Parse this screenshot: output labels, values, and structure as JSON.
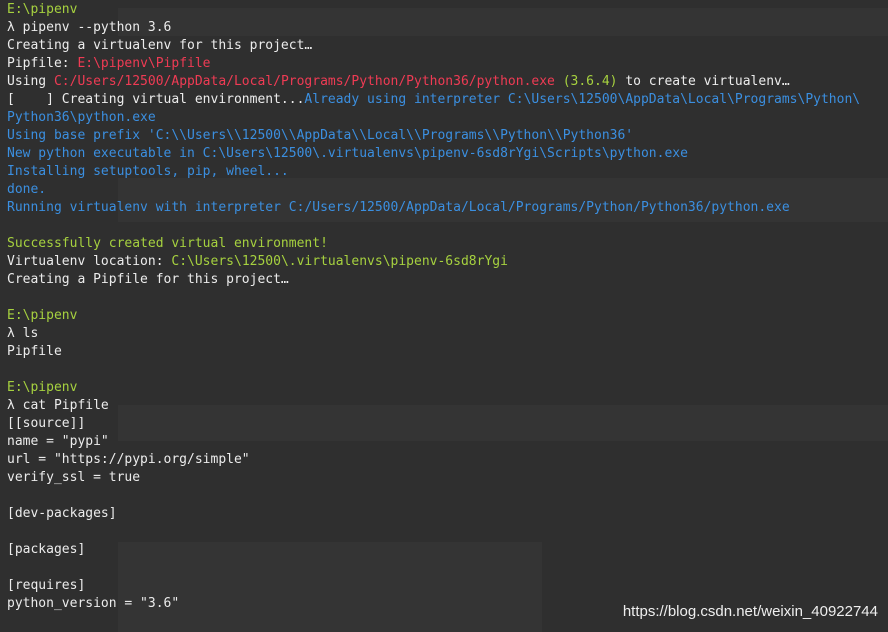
{
  "terminal": {
    "lines": [
      [
        {
          "t": "E:\\pipenv",
          "c": "green"
        }
      ],
      [
        {
          "t": "λ pipenv --python 3.6",
          "c": "white"
        }
      ],
      [
        {
          "t": "Creating a virtualenv for this project…",
          "c": "white"
        }
      ],
      [
        {
          "t": "Pipfile: ",
          "c": "white"
        },
        {
          "t": "E:\\pipenv\\Pipfile",
          "c": "red"
        }
      ],
      [
        {
          "t": "Using ",
          "c": "white"
        },
        {
          "t": "C:/Users/12500/AppData/Local/Programs/Python/Python36/python.exe",
          "c": "red"
        },
        {
          "t": " (3.6.4)",
          "c": "green"
        },
        {
          "t": " to create virtualenv…",
          "c": "white"
        }
      ],
      [
        {
          "t": "[    ] Creating virtual environment...",
          "c": "white"
        },
        {
          "t": "Already using interpreter C:\\Users\\12500\\AppData\\Local\\Programs\\Python\\",
          "c": "blue"
        }
      ],
      [
        {
          "t": "Python36\\python.exe",
          "c": "blue"
        }
      ],
      [
        {
          "t": "Using base prefix 'C:\\\\Users\\\\12500\\\\AppData\\\\Local\\\\Programs\\\\Python\\\\Python36'",
          "c": "blue"
        }
      ],
      [
        {
          "t": "New python executable in C:\\Users\\12500\\.virtualenvs\\pipenv-6sd8rYgi\\Scripts\\python.exe",
          "c": "blue"
        }
      ],
      [
        {
          "t": "Installing setuptools, pip, wheel...",
          "c": "blue"
        }
      ],
      [
        {
          "t": "done.",
          "c": "blue"
        }
      ],
      [
        {
          "t": "Running virtualenv with interpreter C:/Users/12500/AppData/Local/Programs/Python/Python36/python.exe",
          "c": "blue"
        }
      ],
      [
        {
          "t": "",
          "c": "white"
        }
      ],
      [
        {
          "t": "Successfully created virtual environment!",
          "c": "green"
        }
      ],
      [
        {
          "t": "Virtualenv location: ",
          "c": "white"
        },
        {
          "t": "C:\\Users\\12500\\.virtualenvs\\pipenv-6sd8rYgi",
          "c": "green"
        }
      ],
      [
        {
          "t": "Creating a Pipfile for this project…",
          "c": "white"
        }
      ],
      [
        {
          "t": "",
          "c": "white"
        }
      ],
      [
        {
          "t": "E:\\pipenv",
          "c": "green"
        }
      ],
      [
        {
          "t": "λ ls",
          "c": "white"
        }
      ],
      [
        {
          "t": "Pipfile",
          "c": "white"
        }
      ],
      [
        {
          "t": "",
          "c": "white"
        }
      ],
      [
        {
          "t": "E:\\pipenv",
          "c": "green"
        }
      ],
      [
        {
          "t": "λ cat Pipfile",
          "c": "white"
        }
      ],
      [
        {
          "t": "[[source]]",
          "c": "white"
        }
      ],
      [
        {
          "t": "name = \"pypi\"",
          "c": "white"
        }
      ],
      [
        {
          "t": "url = \"https://pypi.org/simple\"",
          "c": "white"
        }
      ],
      [
        {
          "t": "verify_ssl = true",
          "c": "white"
        }
      ],
      [
        {
          "t": "",
          "c": "white"
        }
      ],
      [
        {
          "t": "[dev-packages]",
          "c": "white"
        }
      ],
      [
        {
          "t": "",
          "c": "white"
        }
      ],
      [
        {
          "t": "[packages]",
          "c": "white"
        }
      ],
      [
        {
          "t": "",
          "c": "white"
        }
      ],
      [
        {
          "t": "[requires]",
          "c": "white"
        }
      ],
      [
        {
          "t": "python_version = \"3.6\"",
          "c": "white"
        }
      ]
    ]
  },
  "watermark": {
    "text": "https://blog.csdn.net/weixin_40922744"
  },
  "colors": {
    "background": "#262626",
    "green": "#a6d13f",
    "red": "#ef3b54",
    "blue": "#3b8fe0",
    "white": "#ececec"
  }
}
